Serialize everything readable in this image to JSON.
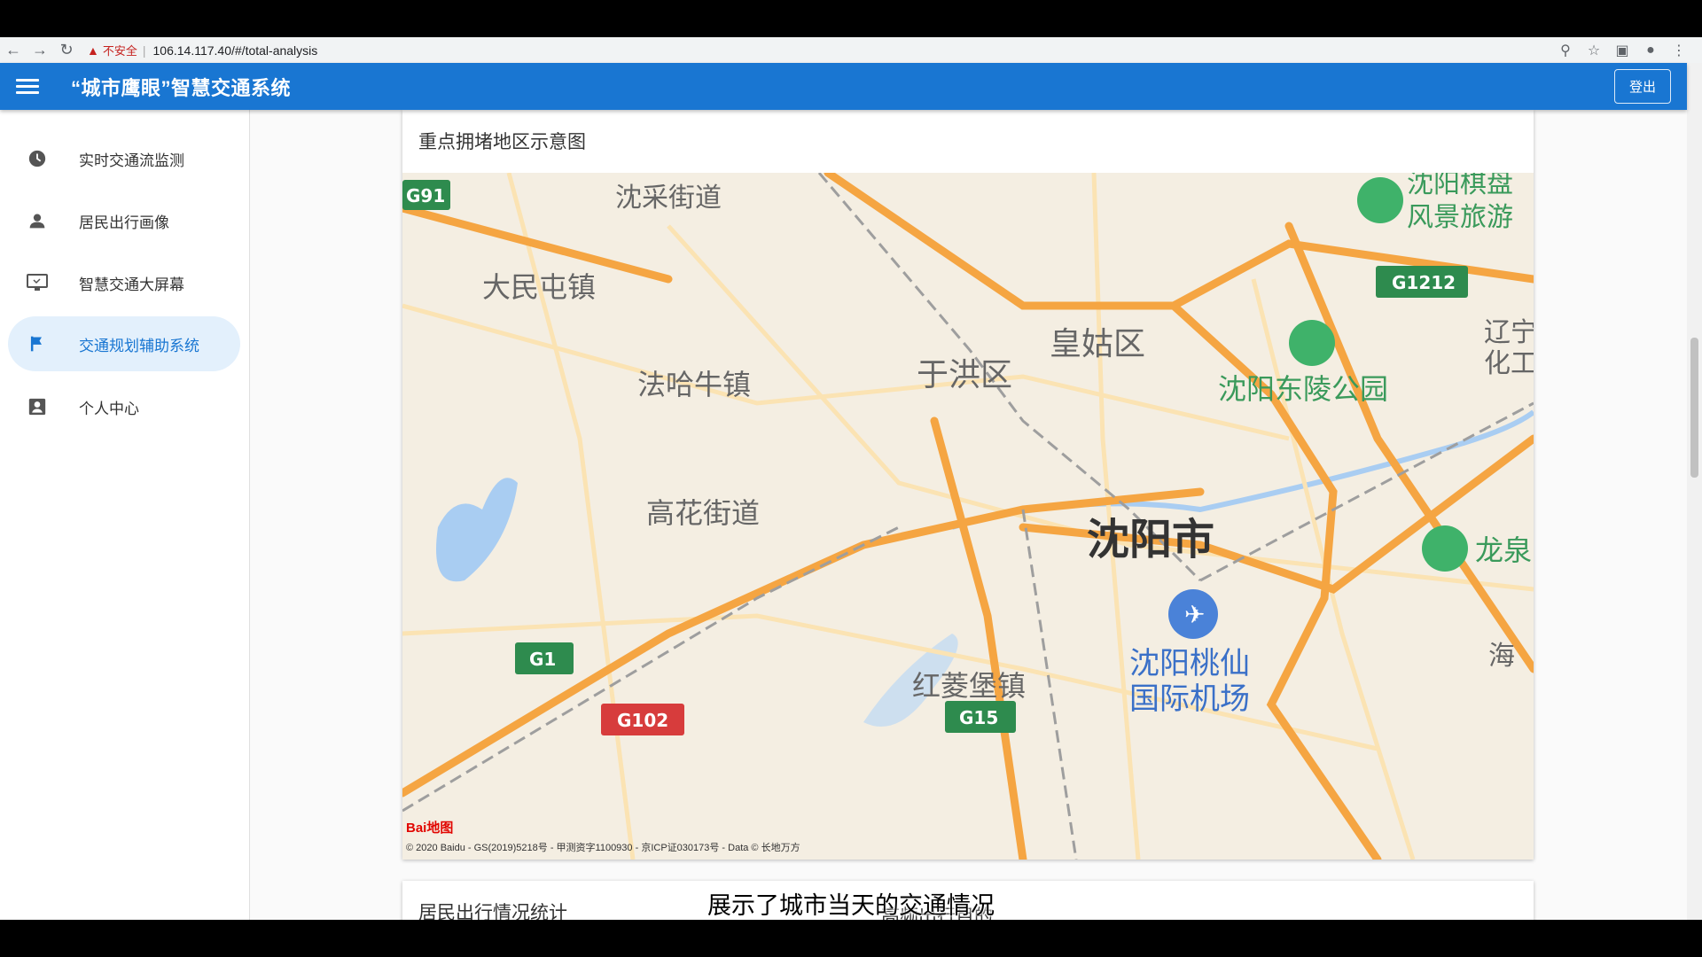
{
  "browser": {
    "insecure_label": "不安全",
    "url": "106.14.117.40/#/total-analysis"
  },
  "header": {
    "title": "“城市鹰眼”智慧交通系统",
    "logout_label": "登出",
    "color": "#1976d2"
  },
  "sidebar": {
    "items": [
      {
        "label": "实时交通流监测",
        "icon": "clock-icon",
        "active": false
      },
      {
        "label": "居民出行画像",
        "icon": "person-icon",
        "active": false
      },
      {
        "label": "智慧交通大屏幕",
        "icon": "monitor-icon",
        "active": false
      },
      {
        "label": "交通规划辅助系统",
        "icon": "flag-icon",
        "active": true
      },
      {
        "label": "个人中心",
        "icon": "account-box-icon",
        "active": false
      }
    ]
  },
  "main": {
    "map_card": {
      "title": "重点拥堵地区示意图",
      "map": {
        "labels": {
          "shencai": "沈采街道",
          "damintun": "大民屯镇",
          "huanggu": "皇姑区",
          "yuhong": "于洪区",
          "fahaniu": "法哈牛镇",
          "gaohua": "高花街道",
          "shenyang": "沈阳市",
          "donglingpark": "沈阳东陵公园",
          "qipan1": "沈阳棋盘",
          "qipan2": "风景旅游",
          "liaoning1": "辽宁",
          "liaoning2": "化工",
          "longquan": "龙泉",
          "taoxian1": "沈阳桃仙",
          "taoxian2": "国际机场",
          "hongling": "红菱堡镇",
          "hai": "海",
          "g91": "G91",
          "g1212": "G1212",
          "g1": "G1",
          "g102": "G102",
          "g15": "G15"
        },
        "baidu_logo": "Bai地图",
        "copyright": "© 2020 Baidu - GS(2019)5218号 - 甲测资字1100930 - 京ICP证030173号 - Data © 长地万方"
      }
    },
    "stats_card": {
      "title": "居民出行情况统计",
      "title_b": "高频出行目的"
    }
  },
  "subtitle": "展示了城市当天的交通情况"
}
